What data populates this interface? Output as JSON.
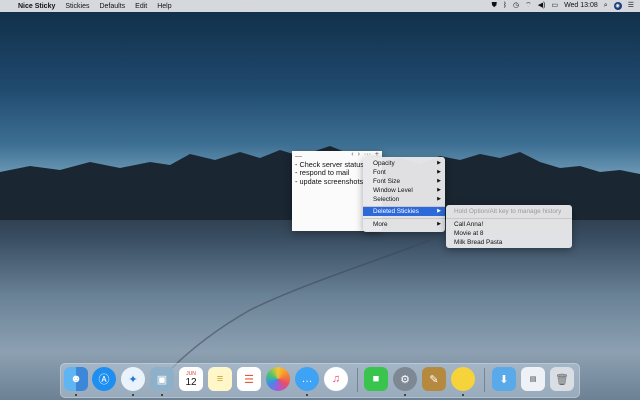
{
  "menubar": {
    "app_name": "Nice Sticky",
    "items": [
      "Stickies",
      "Defaults",
      "Edit",
      "Help"
    ],
    "clock": "Wed 13:08"
  },
  "sticky": {
    "lines": [
      "- Check server status",
      "- respond to mail",
      "- update screenshots"
    ]
  },
  "context_menu": {
    "items": [
      {
        "label": "Opacity",
        "submenu": true
      },
      {
        "label": "Font",
        "submenu": true
      },
      {
        "label": "Font Size",
        "submenu": true
      },
      {
        "label": "Window Level",
        "submenu": true
      },
      {
        "label": "Selection",
        "submenu": true
      },
      {
        "label": "Deleted Stickies",
        "submenu": true,
        "selected": true
      },
      {
        "label": "More",
        "submenu": true
      }
    ]
  },
  "submenu": {
    "hint": "Hold Option/Alt key to manage history",
    "items": [
      "Call Anna!",
      "Movie at 8",
      "Milk Bread Pasta"
    ]
  },
  "dock": {
    "calendar_month": "JUN",
    "calendar_day": "12",
    "apps": [
      "finder-icon",
      "app-store-icon",
      "safari-icon",
      "preview-icon",
      "calendar-icon",
      "notes-icon",
      "reminders-icon",
      "photos-icon",
      "messages-icon",
      "music-icon",
      "facetime-icon",
      "system-preferences-icon",
      "image-capture-icon",
      "nice-sticky-icon",
      "folder-icon",
      "desktop-screenshot-icon",
      "trash-icon"
    ]
  },
  "colors": {
    "selection": "#2d69d9",
    "menu_bg": "#e8e8ea"
  }
}
